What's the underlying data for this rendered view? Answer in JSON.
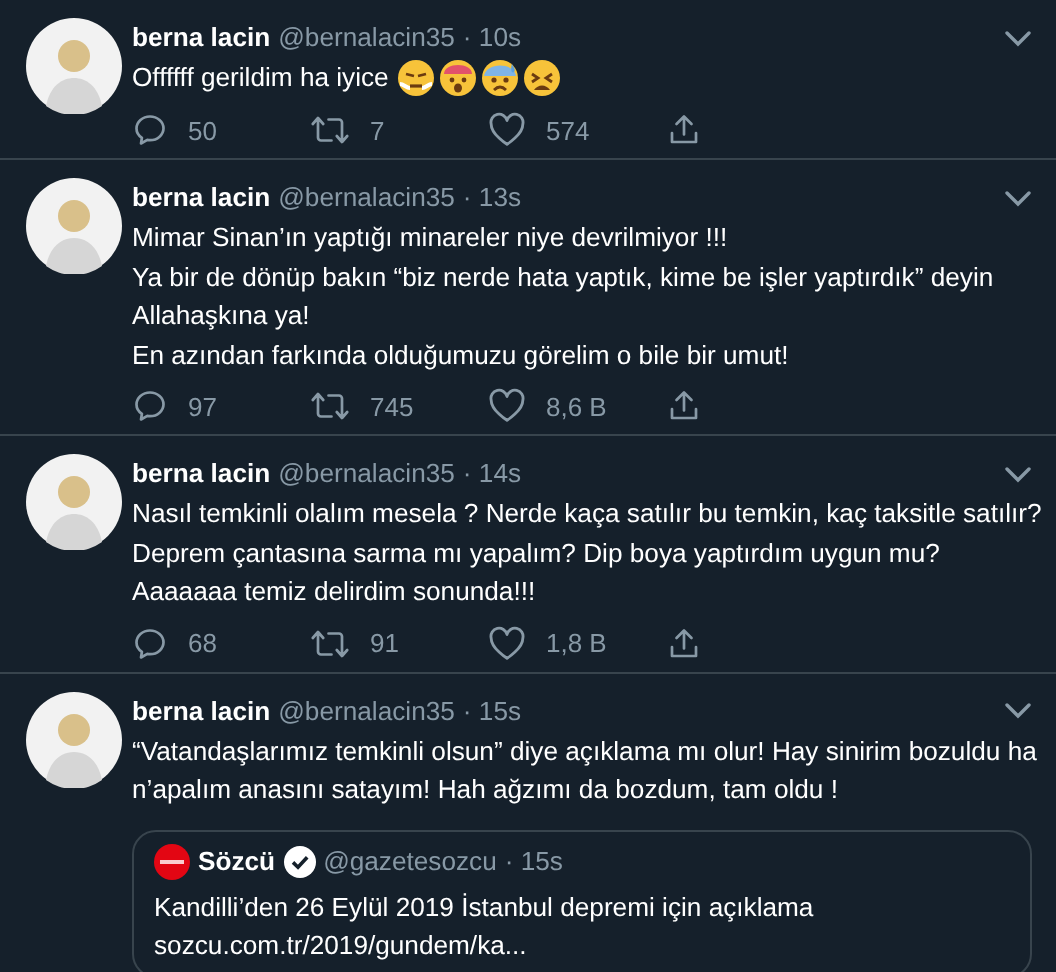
{
  "tweets": [
    {
      "kind": "emoji",
      "name": "berna lacin",
      "handle": "@bernalacin35",
      "time": "· 10s",
      "lines": [
        "Offffff gerildim ha iyice"
      ],
      "stats": {
        "replies": "50",
        "retweets": "7",
        "likes": "574"
      }
    },
    {
      "kind": "text",
      "name": "berna lacin",
      "handle": "@bernalacin35",
      "time": "· 13s",
      "lines": [
        "Mimar Sinan’ın yaptığı minareler niye devrilmiyor !!!",
        "Ya bir de dönüp bakın “biz nerde hata yaptık, kime be işler yaptırdık” deyin",
        "Allahaşkına ya!",
        "En azından farkında olduğumuzu görelim o bile bir umut!"
      ],
      "stats": {
        "replies": "97",
        "retweets": "745",
        "likes": "8,6 B"
      }
    },
    {
      "kind": "text",
      "name": "berna lacin",
      "handle": "@bernalacin35",
      "time": "· 14s",
      "lines": [
        "Nasıl temkinli olalım mesela ? Nerde kaça satılır bu temkin, kaç taksitle satılır?",
        "Deprem çantasına sarma mı yapalım? Dip boya yaptırdım uygun mu?",
        "Aaaaaaa temiz delirdim sonunda!!!"
      ],
      "stats": {
        "replies": "68",
        "retweets": "91",
        "likes": "1,8 B"
      }
    },
    {
      "kind": "quote",
      "name": "berna lacin",
      "handle": "@bernalacin35",
      "time": "· 15s",
      "lines": [
        "“Vatandaşlarımız temkinli olsun” diye açıklama mı olur! Hay sinirim bozuldu ha",
        "n’apalım anasını satayım! Hah ağzımı da bozdum, tam oldu !"
      ],
      "quote": {
        "name": "Sözcü",
        "verified": true,
        "handle": "@gazetesozcu",
        "time": "· 15s",
        "lines": [
          "Kandilli’den 26 Eylül 2019 İstanbul depremi için açıklama",
          "sozcu.com.tr/2019/gundem/ka..."
        ]
      }
    }
  ]
}
